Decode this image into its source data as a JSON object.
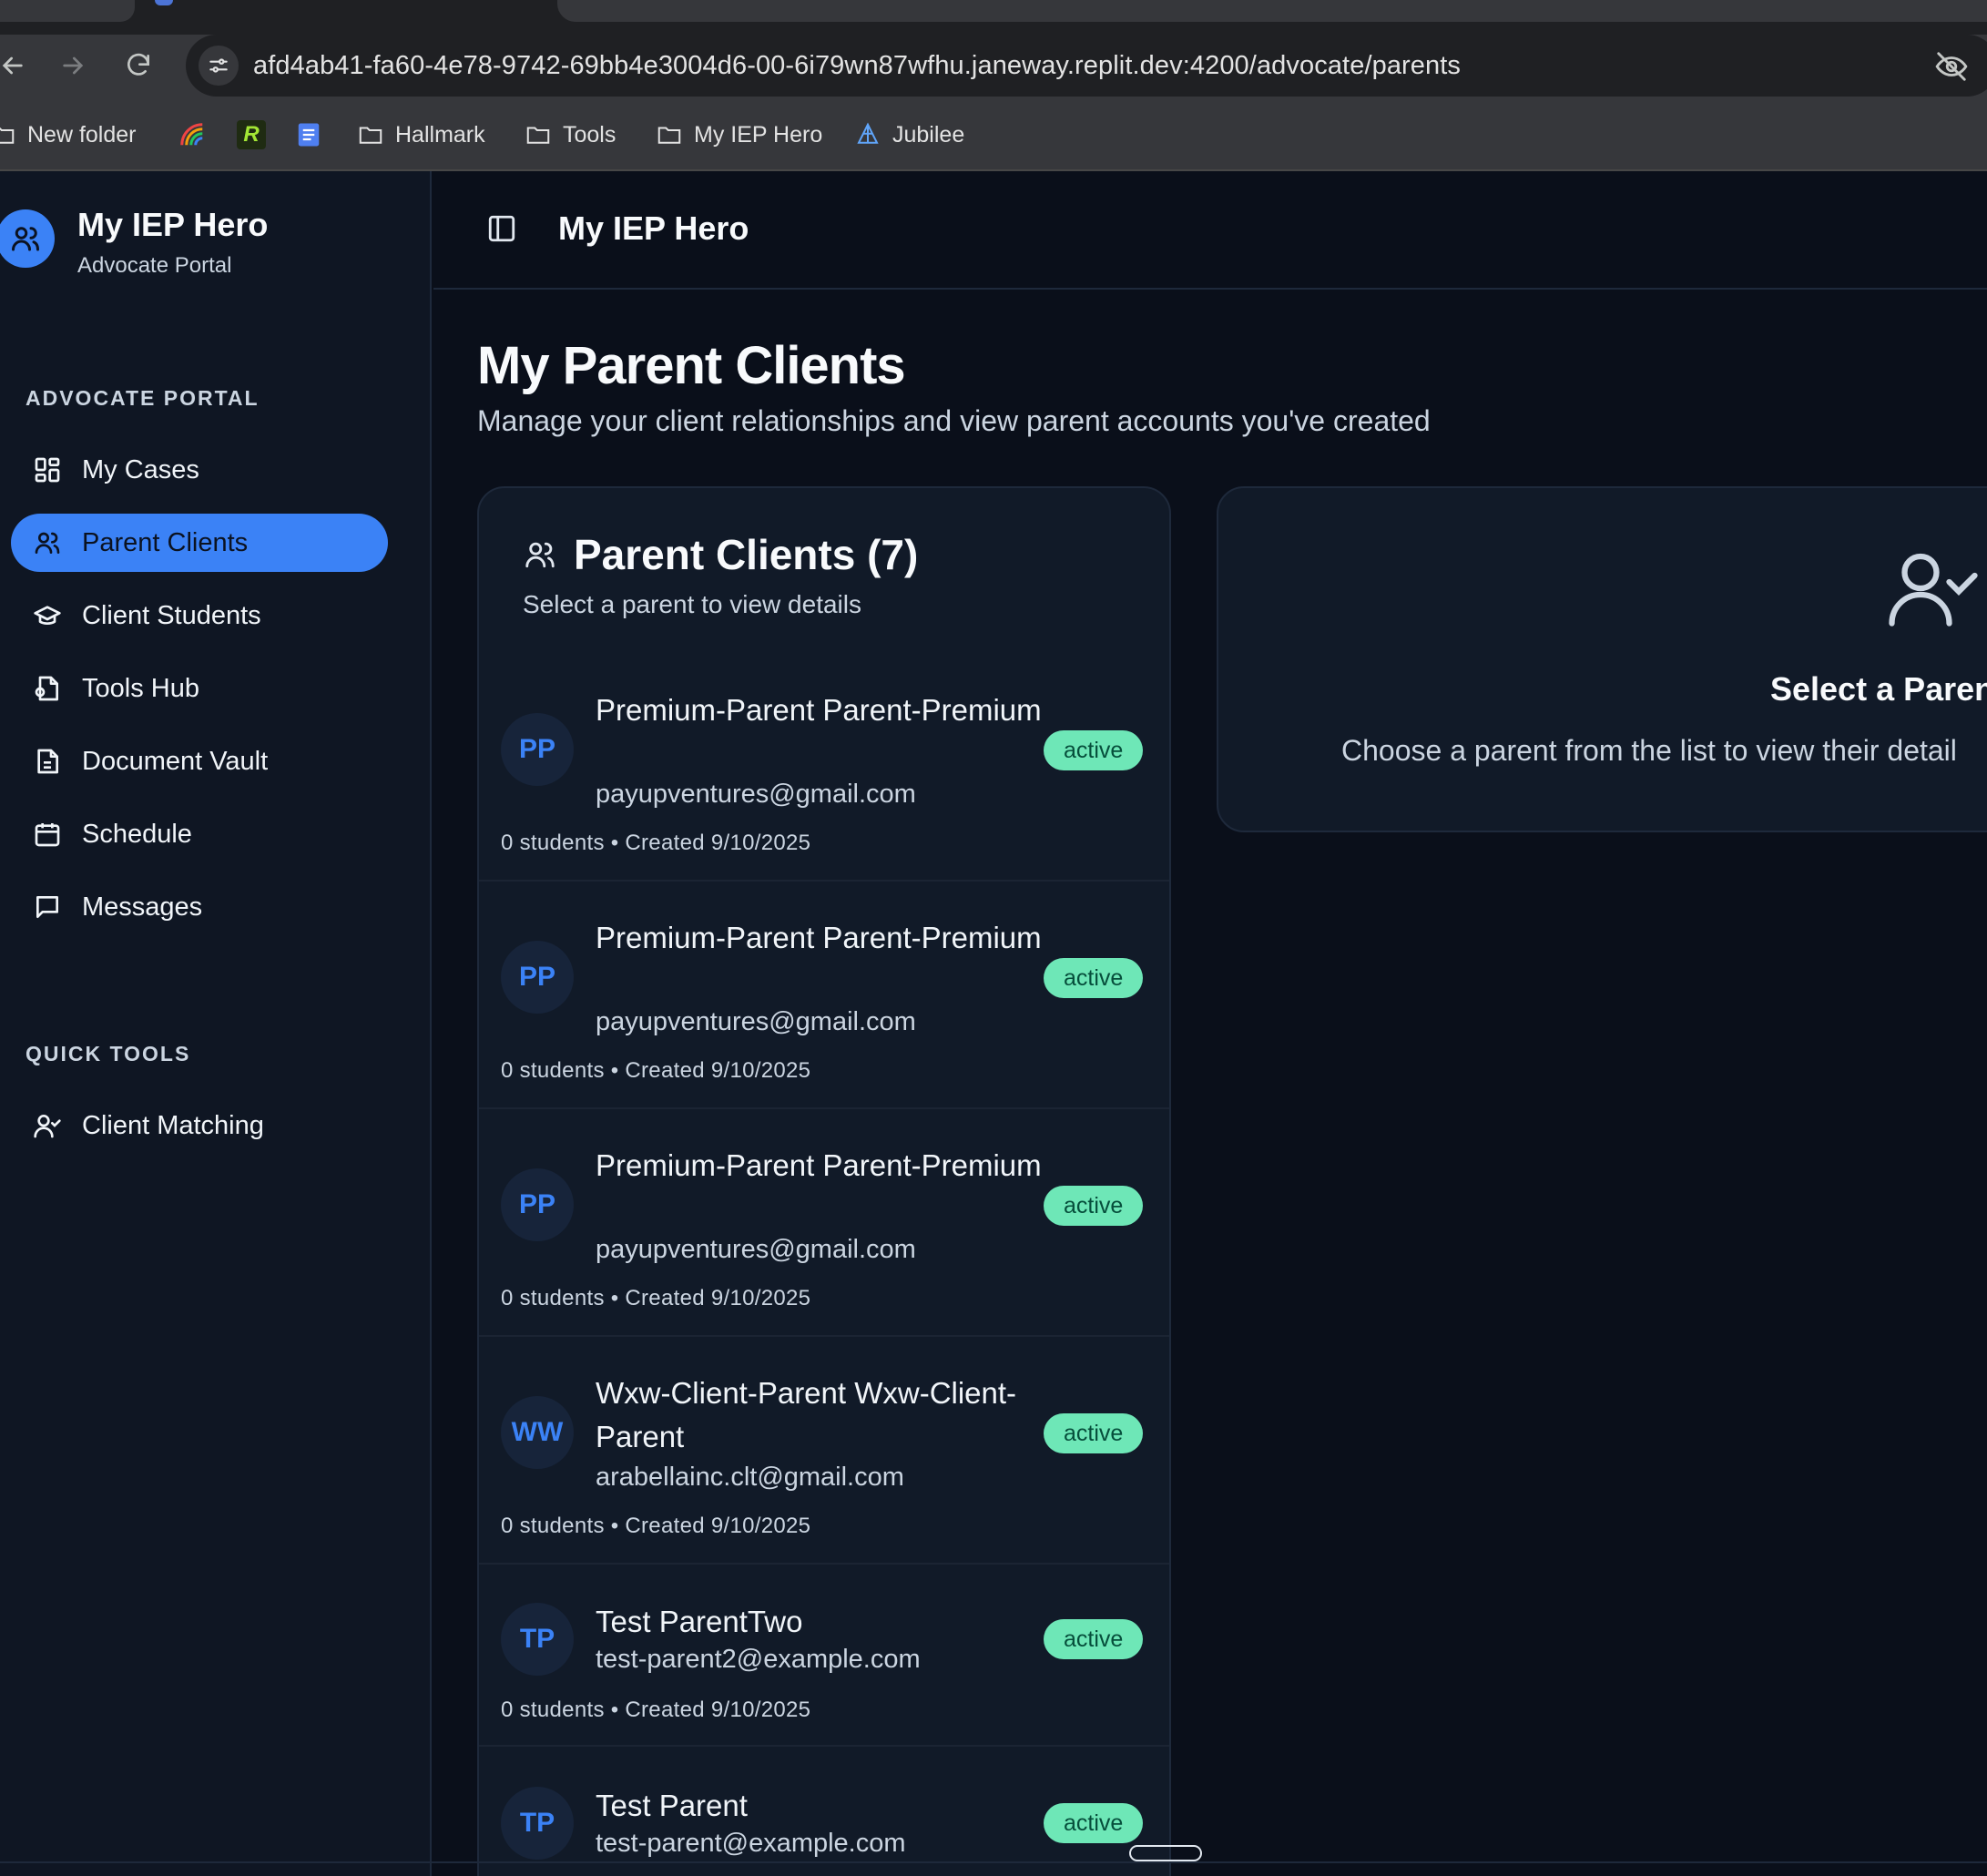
{
  "browser": {
    "url": "afd4ab41-fa60-4e78-9742-69bb4e3004d6-00-6i79wn87wfhu.janeway.replit.dev:4200/advocate/parents",
    "bookmarks": [
      {
        "label": "New folder",
        "icon": "folder-icon"
      },
      {
        "label": "",
        "icon": "rainbow-app-icon"
      },
      {
        "label": "",
        "icon": "green-r-app-icon"
      },
      {
        "label": "",
        "icon": "docs-icon"
      },
      {
        "label": "Hallmark",
        "icon": "folder-icon"
      },
      {
        "label": "Tools",
        "icon": "folder-icon"
      },
      {
        "label": "My IEP Hero",
        "icon": "folder-icon"
      },
      {
        "label": "Jubilee",
        "icon": "jubilee-logo-icon"
      }
    ]
  },
  "sidebar": {
    "brand_title": "My IEP Hero",
    "brand_subtitle": "Advocate Portal",
    "section1": "ADVOCATE PORTAL",
    "items": [
      {
        "label": "My Cases",
        "icon": "grid-icon"
      },
      {
        "label": "Parent Clients",
        "icon": "users-icon",
        "active": true
      },
      {
        "label": "Client Students",
        "icon": "graduation-cap-icon"
      },
      {
        "label": "Tools Hub",
        "icon": "file-tool-icon"
      },
      {
        "label": "Document Vault",
        "icon": "document-icon"
      },
      {
        "label": "Schedule",
        "icon": "calendar-icon"
      },
      {
        "label": "Messages",
        "icon": "message-icon"
      }
    ],
    "section2": "QUICK TOOLS",
    "quick_tools": [
      {
        "label": "Client Matching",
        "icon": "user-check-icon"
      }
    ]
  },
  "header": {
    "title": "My IEP Hero"
  },
  "main": {
    "title": "My Parent Clients",
    "subtitle": "Manage your client relationships and view parent accounts you've created",
    "list": {
      "title": "Parent Clients (7)",
      "subtitle": "Select a parent to view details",
      "parents": [
        {
          "initials": "PP",
          "name": "Premium-Parent Parent-Premium",
          "email": "payupventures@gmail.com",
          "meta": "0 students • Created 9/10/2025",
          "status": "active"
        },
        {
          "initials": "PP",
          "name": "Premium-Parent Parent-Premium",
          "email": "payupventures@gmail.com",
          "meta": "0 students • Created 9/10/2025",
          "status": "active"
        },
        {
          "initials": "PP",
          "name": "Premium-Parent Parent-Premium",
          "email": "payupventures@gmail.com",
          "meta": "0 students • Created 9/10/2025",
          "status": "active"
        },
        {
          "initials": "WW",
          "name": "Wxw-Client-Parent Wxw-Client-Parent",
          "email": "arabellainc.clt@gmail.com",
          "meta": "0 students • Created 9/10/2025",
          "status": "active"
        },
        {
          "initials": "TP",
          "name": "Test ParentTwo",
          "email": "test-parent2@example.com",
          "meta": "0 students • Created 9/10/2025",
          "status": "active"
        },
        {
          "initials": "TP",
          "name": "Test Parent",
          "email": "test-parent@example.com",
          "meta": "",
          "status": "active"
        }
      ]
    },
    "detail": {
      "title": "Select a Paren",
      "subtitle": "Choose a parent from the list to view their detail"
    }
  },
  "colors": {
    "accent": "#3b82f6",
    "badge_bg": "#6ee7b7",
    "badge_text": "#064e3b",
    "background": "#0a0f1a",
    "card": "#111a28"
  }
}
